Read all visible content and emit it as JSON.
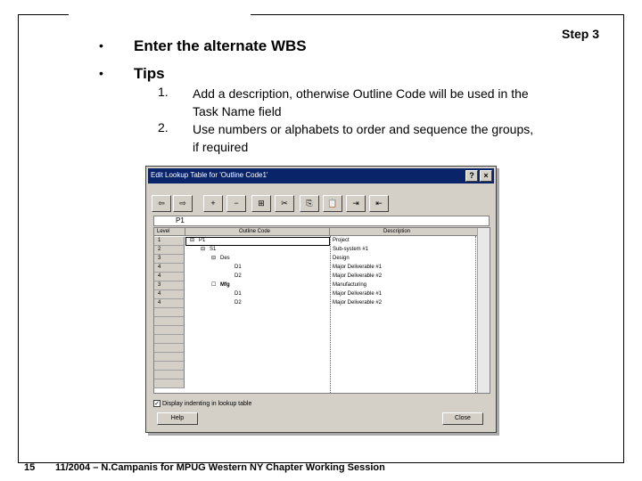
{
  "slide": {
    "step_label": "Step 3",
    "bullets": [
      {
        "marker": "•",
        "text": "Enter the alternate WBS"
      },
      {
        "marker": "•",
        "text": "Tips"
      }
    ],
    "tips": [
      {
        "number": "1.",
        "text": "Add a description, otherwise Outline Code will be used in the Task Name field"
      },
      {
        "number": "2.",
        "text": "Use numbers or alphabets to order and sequence the groups, if required"
      }
    ],
    "footer": {
      "page_number": "15",
      "text": "11/2004 – N.Campanis for MPUG Western NY Chapter Working Session"
    }
  },
  "dialog": {
    "title": "Edit Lookup Table for 'Outline Code1'",
    "help_glyph": "?",
    "close_glyph": "×",
    "toolbar_icons": [
      {
        "name": "move-left-icon",
        "glyph": "⇦"
      },
      {
        "name": "move-right-icon",
        "glyph": "⇨"
      },
      {
        "name": "expand-icon",
        "glyph": "+"
      },
      {
        "name": "collapse-icon",
        "glyph": "−"
      },
      {
        "name": "expand-all-icon",
        "glyph": "⊞"
      },
      {
        "name": "cut-icon",
        "glyph": "✂"
      },
      {
        "name": "copy-icon",
        "glyph": "⎘"
      },
      {
        "name": "paste-icon",
        "glyph": "📋"
      },
      {
        "name": "insert-row-icon",
        "glyph": "⇥"
      },
      {
        "name": "delete-row-icon",
        "glyph": "⇤"
      }
    ],
    "edit_value": "P1",
    "columns": {
      "level": "Level",
      "outline_code": "Outline Code",
      "description": "Description"
    },
    "rows": [
      {
        "level": "1",
        "code": "P1",
        "description": "Project",
        "toggle": "⊟"
      },
      {
        "level": "2",
        "code": "S1",
        "description": "Sub-system #1",
        "toggle": "⊟"
      },
      {
        "level": "3",
        "code": "Des",
        "description": "Design",
        "toggle": "⊟"
      },
      {
        "level": "4",
        "code": "D1",
        "description": "Major Deliverable #1",
        "toggle": ""
      },
      {
        "level": "4",
        "code": "D2",
        "description": "Major Deliverable #2",
        "toggle": ""
      },
      {
        "level": "3",
        "code": "Mfg",
        "description": "Manufacturing",
        "toggle": "☐"
      },
      {
        "level": "4",
        "code": "D1",
        "description": "Major Deliverable #1",
        "toggle": ""
      },
      {
        "level": "4",
        "code": "D2",
        "description": "Major Deliverable #2",
        "toggle": ""
      }
    ],
    "checkbox_label": "Display indenting in lookup table",
    "checkbox_mark": "✓",
    "help_button": "Help",
    "close_button": "Close"
  }
}
